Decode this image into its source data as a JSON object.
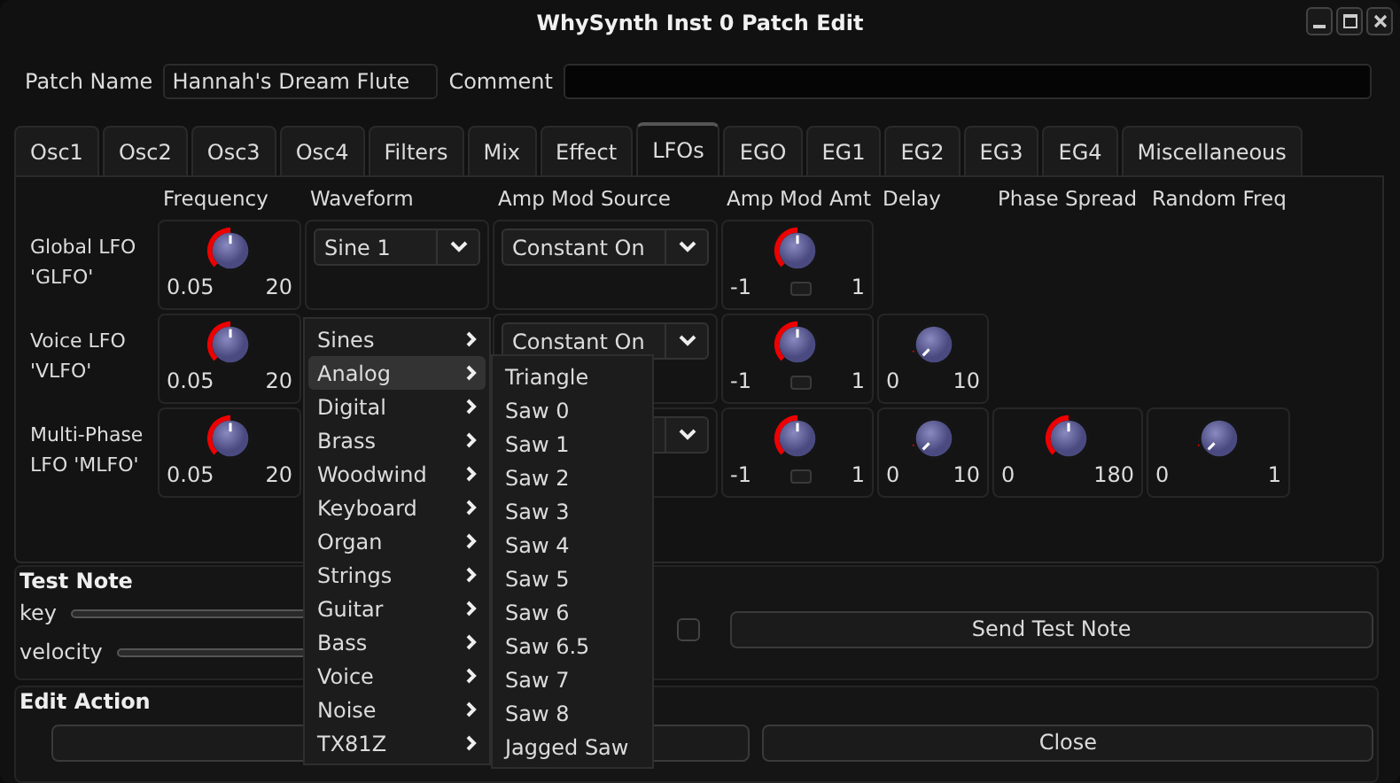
{
  "window": {
    "title": "WhySynth Inst 0 Patch Edit"
  },
  "patch": {
    "name_label": "Patch Name",
    "name_value": "Hannah's Dream Flute",
    "comment_label": "Comment"
  },
  "tabs": [
    {
      "label": "Osc1",
      "selected": false
    },
    {
      "label": "Osc2",
      "selected": false
    },
    {
      "label": "Osc3",
      "selected": false
    },
    {
      "label": "Osc4",
      "selected": false
    },
    {
      "label": "Filters",
      "selected": false
    },
    {
      "label": "Mix",
      "selected": false
    },
    {
      "label": "Effect",
      "selected": false
    },
    {
      "label": "LFOs",
      "selected": true
    },
    {
      "label": "EGO",
      "selected": false
    },
    {
      "label": "EG1",
      "selected": false
    },
    {
      "label": "EG2",
      "selected": false
    },
    {
      "label": "EG3",
      "selected": false
    },
    {
      "label": "EG4",
      "selected": false
    },
    {
      "label": "Miscellaneous",
      "selected": false
    }
  ],
  "lfo": {
    "columns": [
      "Frequency",
      "Waveform",
      "Amp Mod Source",
      "Amp Mod Amt",
      "Delay",
      "Phase Spread",
      "Random Freq"
    ],
    "rows": [
      {
        "label": "Global LFO 'GLFO'",
        "frequency": {
          "level": 0.5,
          "min": "0.05",
          "max": "20"
        },
        "waveform": {
          "value": "Sine 1"
        },
        "amp_mod_source": {
          "value": "Constant On"
        },
        "amp_mod_amt": {
          "level": 0.5,
          "min": "-1",
          "max": "1",
          "toggle": {
            "on": false
          }
        }
      },
      {
        "label": "Voice LFO 'VLFO'",
        "frequency": {
          "level": 0.5,
          "min": "0.05",
          "max": "20"
        },
        "amp_mod_source": {
          "value": "Constant On"
        },
        "amp_mod_amt": {
          "level": 0.5,
          "min": "-1",
          "max": "1",
          "toggle": {
            "on": false
          }
        },
        "delay": {
          "level": 0,
          "min": "0",
          "max": "10"
        }
      },
      {
        "label": "Multi-Phase LFO 'MLFO'",
        "frequency": {
          "level": 0.5,
          "min": "0.05",
          "max": "20"
        },
        "amp_mod_source": {},
        "amp_mod_amt": {
          "level": 0.5,
          "min": "-1",
          "max": "1",
          "toggle": {
            "on": false
          }
        },
        "delay": {
          "level": 0,
          "min": "0",
          "max": "10"
        },
        "phase_spread": {
          "level": 0.5,
          "min": "0",
          "max": "180"
        },
        "random_freq": {
          "level": 0,
          "min": "0",
          "max": "1"
        }
      }
    ]
  },
  "test_note": {
    "title": "Test Note",
    "sliders": [
      {
        "label": "key"
      },
      {
        "label": "velocity"
      }
    ],
    "checkbox": {
      "checked": false
    },
    "button": "Send Test Note"
  },
  "edit_action": {
    "title": "Edit Action",
    "close_button": "Close"
  },
  "menu": {
    "items": [
      {
        "label": "Sines",
        "selected": false
      },
      {
        "label": "Analog",
        "selected": true
      },
      {
        "label": "Digital",
        "selected": false
      },
      {
        "label": "Brass",
        "selected": false
      },
      {
        "label": "Woodwind",
        "selected": false
      },
      {
        "label": "Keyboard",
        "selected": false
      },
      {
        "label": "Organ",
        "selected": false
      },
      {
        "label": "Strings",
        "selected": false
      },
      {
        "label": "Guitar",
        "selected": false
      },
      {
        "label": "Bass",
        "selected": false
      },
      {
        "label": "Voice",
        "selected": false
      },
      {
        "label": "Noise",
        "selected": false
      },
      {
        "label": "TX81Z",
        "selected": false
      }
    ],
    "submenu": [
      "Triangle",
      "Saw 0",
      "Saw 1",
      "Saw 2",
      "Saw 3",
      "Saw 4",
      "Saw 5",
      "Saw 6",
      "Saw 6.5",
      "Saw 7",
      "Saw 8",
      "Jagged Saw"
    ]
  }
}
